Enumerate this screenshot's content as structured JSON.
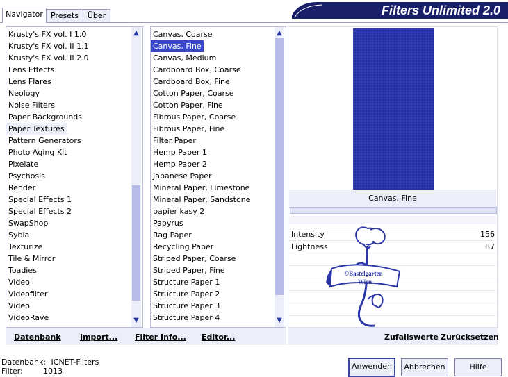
{
  "tabs": [
    {
      "label": "Navigator"
    },
    {
      "label": "Presets"
    },
    {
      "label": "Über"
    }
  ],
  "banner": {
    "title": "Filters Unlimited 2.0"
  },
  "categories": [
    "Krusty's FX vol. I 1.0",
    "Krusty's FX vol. II 1.1",
    "Krusty's FX vol. II 2.0",
    "Lens Effects",
    "Lens Flares",
    "Neology",
    "Noise Filters",
    "Paper Backgrounds",
    "Paper Textures",
    "Pattern Generators",
    "Photo Aging Kit",
    "Pixelate",
    "Psychosis",
    "Render",
    "Special Effects 1",
    "Special Effects 2",
    "SwapShop",
    "Sybia",
    "Texturize",
    "Tile & Mirror",
    "Toadies",
    "Video",
    "Videofilter",
    "Video",
    "VideoRave"
  ],
  "selected_category": "Paper Textures",
  "filters": [
    "Canvas, Coarse",
    "Canvas, Fine",
    "Canvas, Medium",
    "Cardboard Box, Coarse",
    "Cardboard Box, Fine",
    "Cotton Paper, Coarse",
    "Cotton Paper, Fine",
    "Fibrous Paper, Coarse",
    "Fibrous Paper, Fine",
    "Filter Paper",
    "Hemp Paper 1",
    "Hemp Paper 2",
    "Japanese Paper",
    "Mineral Paper, Limestone",
    "Mineral Paper, Sandstone",
    "papier kasy 2",
    "Papyrus",
    "Rag Paper",
    "Recycling Paper",
    "Striped Paper, Coarse",
    "Striped Paper, Fine",
    "Structure Paper 1",
    "Structure Paper 2",
    "Structure Paper 3",
    "Structure Paper 4"
  ],
  "selected_filter": "Canvas, Fine",
  "preview": {
    "filter_name": "Canvas, Fine",
    "color": "#2a35a6"
  },
  "parameters": [
    {
      "label": "Intensity",
      "value": "156"
    },
    {
      "label": "Lightness",
      "value": "87"
    }
  ],
  "watermark": {
    "text_line1": "©Bastelgarten",
    "text_line2": "Wien",
    "color": "#2a35a6"
  },
  "bottom_links": {
    "database": "Datenbank",
    "import": "Import...",
    "filter_info": "Filter Info...",
    "editor": "Editor...",
    "randomize": "Zufallswerte",
    "reset": "Zurücksetzen"
  },
  "status": {
    "database_label": "Datenbank:",
    "database_value": "ICNET-Filters",
    "filter_label": "Filter:",
    "filter_value": "1013"
  },
  "buttons": {
    "apply": "Anwenden",
    "cancel": "Abbrechen",
    "help": "Hilfe"
  },
  "colors": {
    "accent": "#3a46c8",
    "panel_bg": "#eceff9",
    "banner": "#1a1f6a"
  }
}
